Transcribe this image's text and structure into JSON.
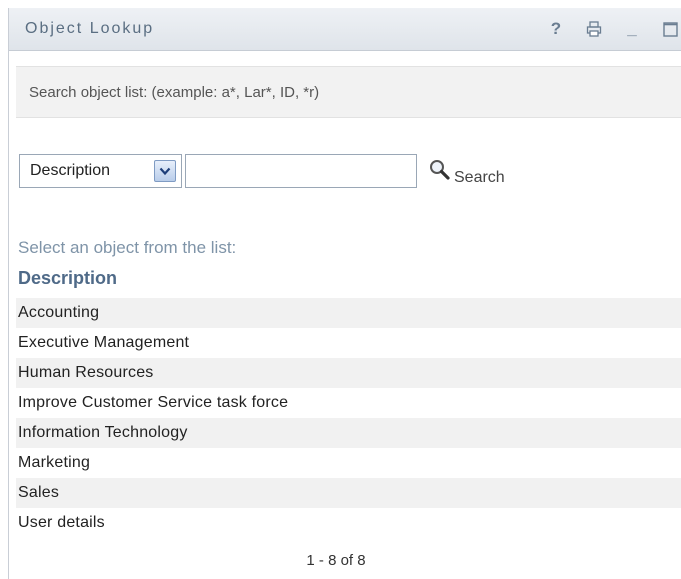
{
  "window": {
    "title": "Object Lookup",
    "controls": [
      "help-icon",
      "print-icon",
      "minimize-icon",
      "maximize-icon"
    ],
    "help_glyph": "?",
    "minimize_glyph": "_"
  },
  "search": {
    "hint": "Search object list: (example: a*, Lar*, ID, *r)",
    "field_selected": "Description",
    "query_value": "",
    "button_label": "Search"
  },
  "results": {
    "prompt": "Select an object from the list:",
    "column_header": "Description",
    "items": [
      "Accounting",
      "Executive Management",
      "Human Resources",
      "Improve Customer Service task force",
      "Information Technology",
      "Marketing",
      "Sales",
      "User details"
    ],
    "pagination": "1 - 8 of 8"
  },
  "colors": {
    "title_text": "#5a6e82",
    "header_text": "#4f6a88",
    "prompt_text": "#7f94a8",
    "row_stripe": "#f1f1f1"
  }
}
